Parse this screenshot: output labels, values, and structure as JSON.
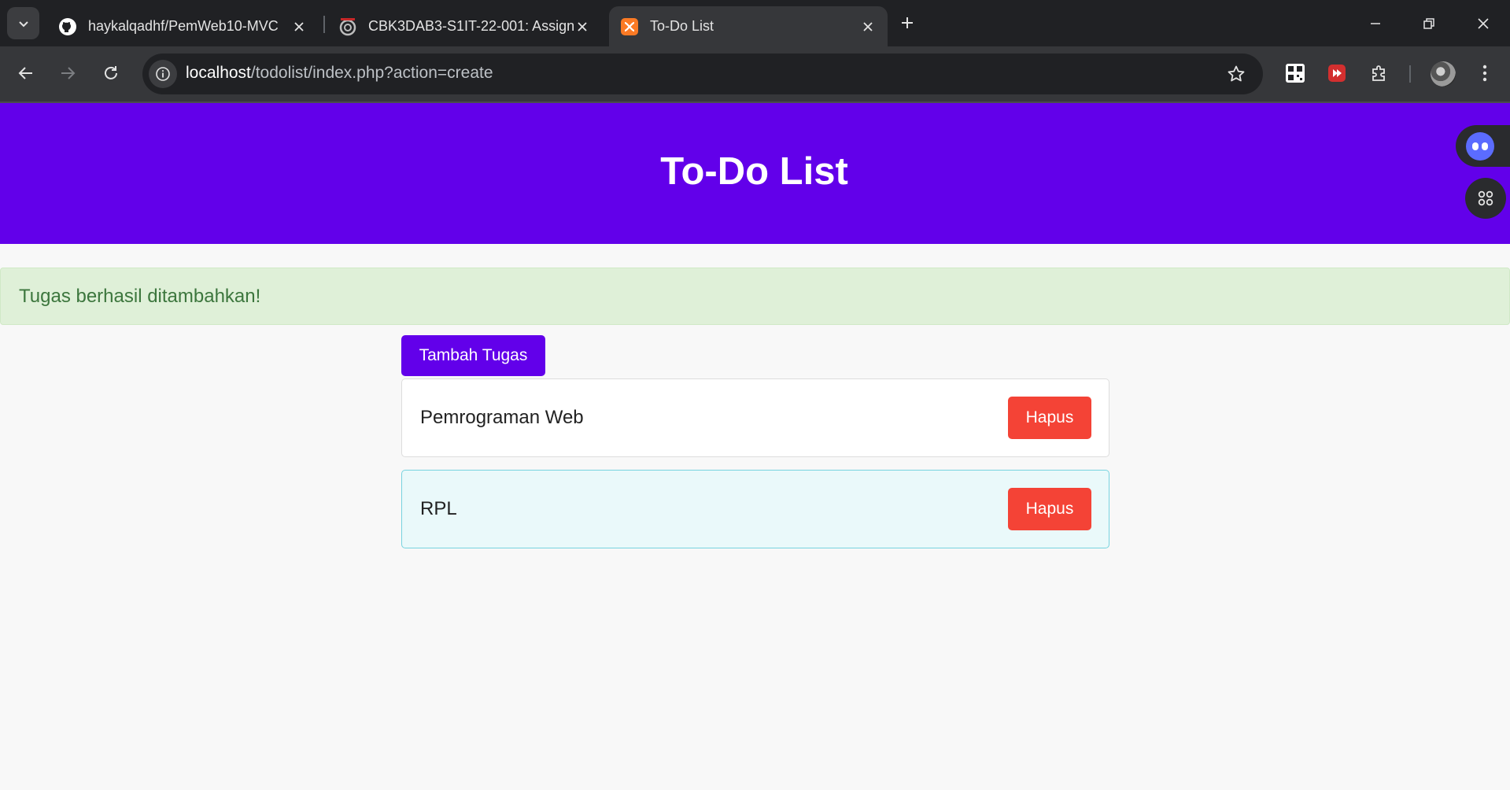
{
  "browser": {
    "tabs": [
      {
        "title": "haykalqadhf/PemWeb10-MVC",
        "icon": "github-icon"
      },
      {
        "title": "CBK3DAB3-S1IT-22-001: Assign",
        "icon": "course-site-icon"
      },
      {
        "title": "To-Do List",
        "icon": "xampp-icon",
        "active": true
      }
    ],
    "url_host": "localhost",
    "url_path": "/todolist/index.php?action=create"
  },
  "page": {
    "title": "To-Do List",
    "alert": "Tugas berhasil ditambahkan!",
    "add_button": "Tambah Tugas",
    "tasks": [
      {
        "name": "Pemrograman Web",
        "delete_label": "Hapus"
      },
      {
        "name": "RPL",
        "delete_label": "Hapus"
      }
    ]
  },
  "colors": {
    "header": "#6200ea",
    "alert_bg": "#dff0d8",
    "alert_text": "#3c763d",
    "delete": "#f44336",
    "highlight_bg": "#eaf9fa"
  }
}
